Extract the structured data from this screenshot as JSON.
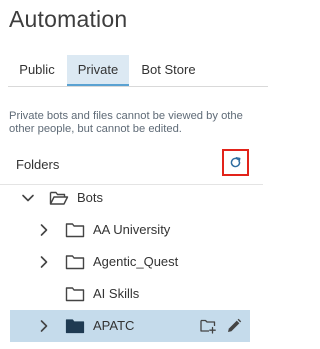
{
  "page": {
    "title": "Automation"
  },
  "tabs": [
    {
      "label": "Public",
      "active": false
    },
    {
      "label": "Private",
      "active": true
    },
    {
      "label": "Bot Store",
      "active": false
    }
  ],
  "description": {
    "line1": "Private bots and files cannot be viewed by othe",
    "line2": "other people, but cannot be edited."
  },
  "folders_panel": {
    "label": "Folders",
    "refresh_icon": "refresh-icon"
  },
  "tree": {
    "root": {
      "label": "Bots",
      "expanded": true,
      "icon": "folder-open-icon"
    },
    "children": [
      {
        "label": "AA University",
        "expandable": true,
        "icon": "folder-icon"
      },
      {
        "label": "Agentic_Quest",
        "expandable": true,
        "icon": "folder-icon"
      },
      {
        "label": "AI Skills",
        "expandable": false,
        "icon": "folder-icon"
      },
      {
        "label": "APATC",
        "expandable": true,
        "selected": true,
        "icon": "folder-filled-icon",
        "actions": [
          "add-folder-icon",
          "edit-pencil-icon"
        ]
      }
    ]
  },
  "colors": {
    "accent": "#5aa2d2",
    "selected_bg": "#c5dbeb",
    "highlight_box": "#e2231a",
    "tab_active_bg": "#dce9f3"
  }
}
